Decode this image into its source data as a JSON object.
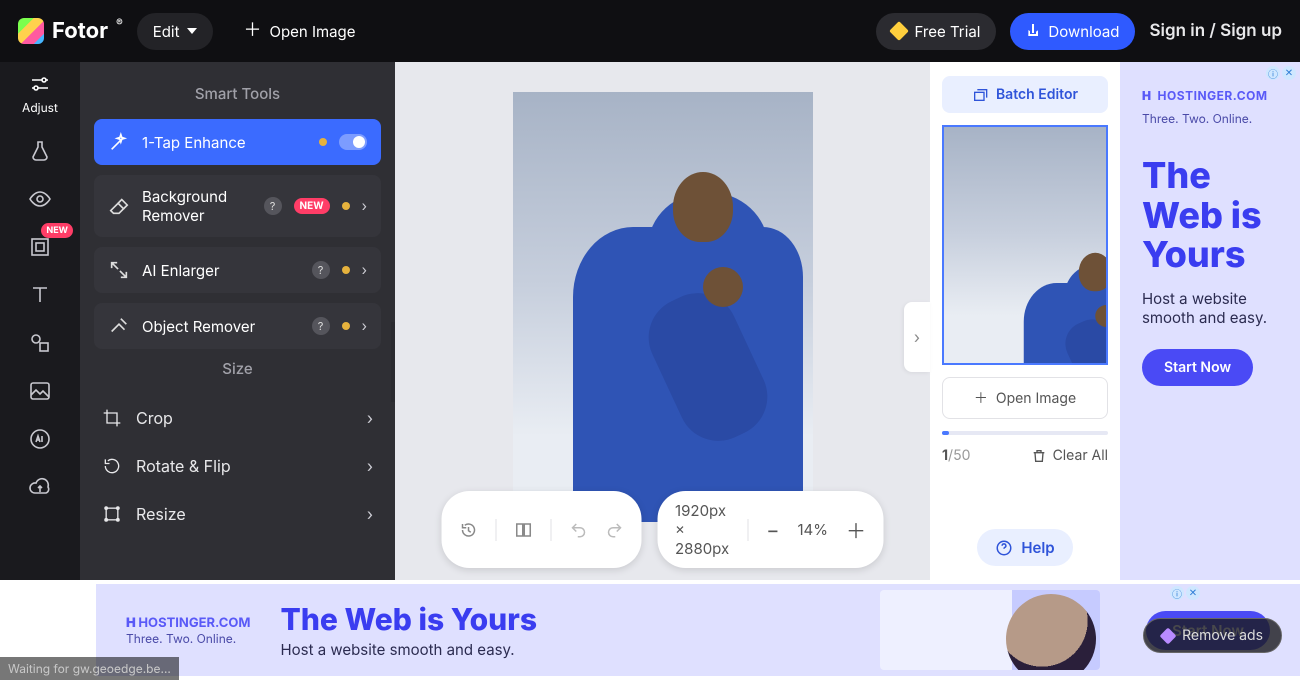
{
  "app": {
    "name": "Fotor",
    "trademark": "®"
  },
  "topbar": {
    "edit": "Edit",
    "open_image": "Open Image",
    "free_trial": "Free Trial",
    "download": "Download",
    "sign": "Sign in / Sign up"
  },
  "rail": {
    "adjust": "Adjust",
    "new_badge": "NEW"
  },
  "sidepanel": {
    "smart_tools_title": "Smart Tools",
    "size_title": "Size",
    "tools": {
      "enhance": "1-Tap Enhance",
      "bg_remover": "Background Remover",
      "ai_enlarger": "AI Enlarger",
      "object_remover": "Object Remover",
      "new_badge": "NEW"
    },
    "size": {
      "crop": "Crop",
      "rotate": "Rotate & Flip",
      "resize": "Resize"
    }
  },
  "canvas": {
    "dimensions": "1920px × 2880px",
    "zoom": "14%"
  },
  "rpanel": {
    "batch": "Batch Editor",
    "open_image": "Open Image",
    "count_current": "1",
    "count_sep": "/",
    "count_total": "50",
    "clear_all": "Clear All",
    "help": "Help"
  },
  "ad_side": {
    "brand": "HOSTINGER.COM",
    "tag": "Three. Two. Online.",
    "headline": "The Web is Yours",
    "sub": "Host a website smooth and easy.",
    "cta": "Start Now"
  },
  "ad_bottom": {
    "brand": "HOSTINGER.COM",
    "tag": "Three. Two. Online.",
    "headline": "The Web is Yours",
    "sub": "Host a website smooth and easy.",
    "cta": "Start Now",
    "remove": "Remove ads"
  },
  "status": "Waiting for gw.geoedge.be..."
}
